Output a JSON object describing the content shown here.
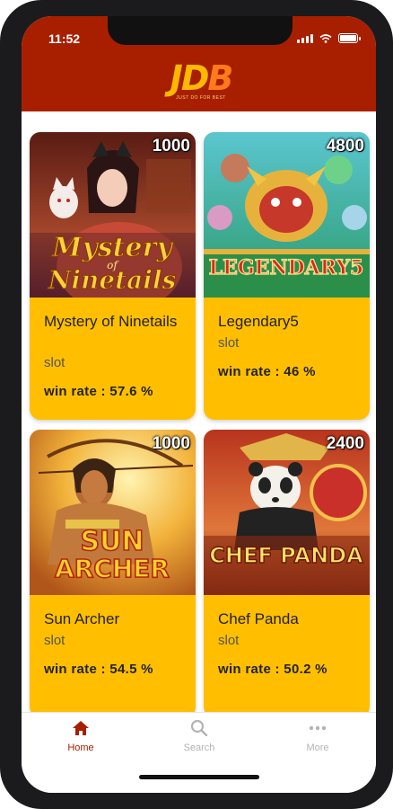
{
  "status_bar": {
    "time": "11:52"
  },
  "header": {
    "logo_text": "JDB",
    "logo_tagline": "JUST DO FOR BEST"
  },
  "games": [
    {
      "title": "Mystery of Ninetails",
      "type": "slot",
      "win_rate": "win rate : 57.6 %",
      "badge": "1000",
      "art_text_1": "Mystery",
      "art_text_2": "of",
      "art_text_3": "Ninetails"
    },
    {
      "title": "Legendary5",
      "type": "slot",
      "win_rate": "win rate : 46 %",
      "badge": "4800",
      "art_text_1": "LEGENDARY5"
    },
    {
      "title": "Sun Archer",
      "type": "slot",
      "win_rate": "win rate : 54.5 %",
      "badge": "1000",
      "art_text_1": "SUN",
      "art_text_2": "ARCHER"
    },
    {
      "title": "Chef Panda",
      "type": "slot",
      "win_rate": "win rate : 50.2 %",
      "badge": "2400",
      "art_text_1": "CHEF PANDA"
    }
  ],
  "tabs": [
    {
      "label": "Home",
      "icon": "home-icon",
      "active": true
    },
    {
      "label": "Search",
      "icon": "search-icon",
      "active": false
    },
    {
      "label": "More",
      "icon": "more-icon",
      "active": false
    }
  ],
  "colors": {
    "header": "#a81f00",
    "card": "#ffbf00",
    "active_tab": "#a81f00",
    "inactive_tab": "#b4b4b4"
  }
}
